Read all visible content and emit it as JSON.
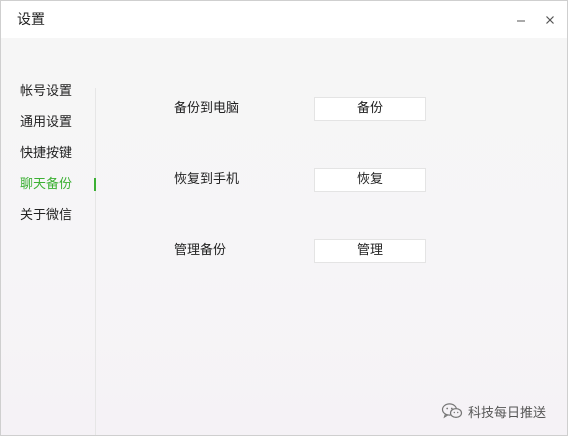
{
  "window": {
    "title": "设置",
    "minimize_icon": "minimize-icon",
    "close_icon": "close-icon"
  },
  "sidebar": {
    "items": [
      {
        "label": "帐号设置",
        "active": false
      },
      {
        "label": "通用设置",
        "active": false
      },
      {
        "label": "快捷按键",
        "active": false
      },
      {
        "label": "聊天备份",
        "active": true
      },
      {
        "label": "关于微信",
        "active": false
      }
    ]
  },
  "main": {
    "rows": [
      {
        "label": "备份到电脑",
        "button": "备份"
      },
      {
        "label": "恢复到手机",
        "button": "恢复"
      },
      {
        "label": "管理备份",
        "button": "管理"
      }
    ]
  },
  "watermark": {
    "icon": "wechat-icon",
    "text": "科技每日推送"
  },
  "colors": {
    "accent": "#3cb034",
    "text": "#222222",
    "background": "#f6f6f6"
  }
}
